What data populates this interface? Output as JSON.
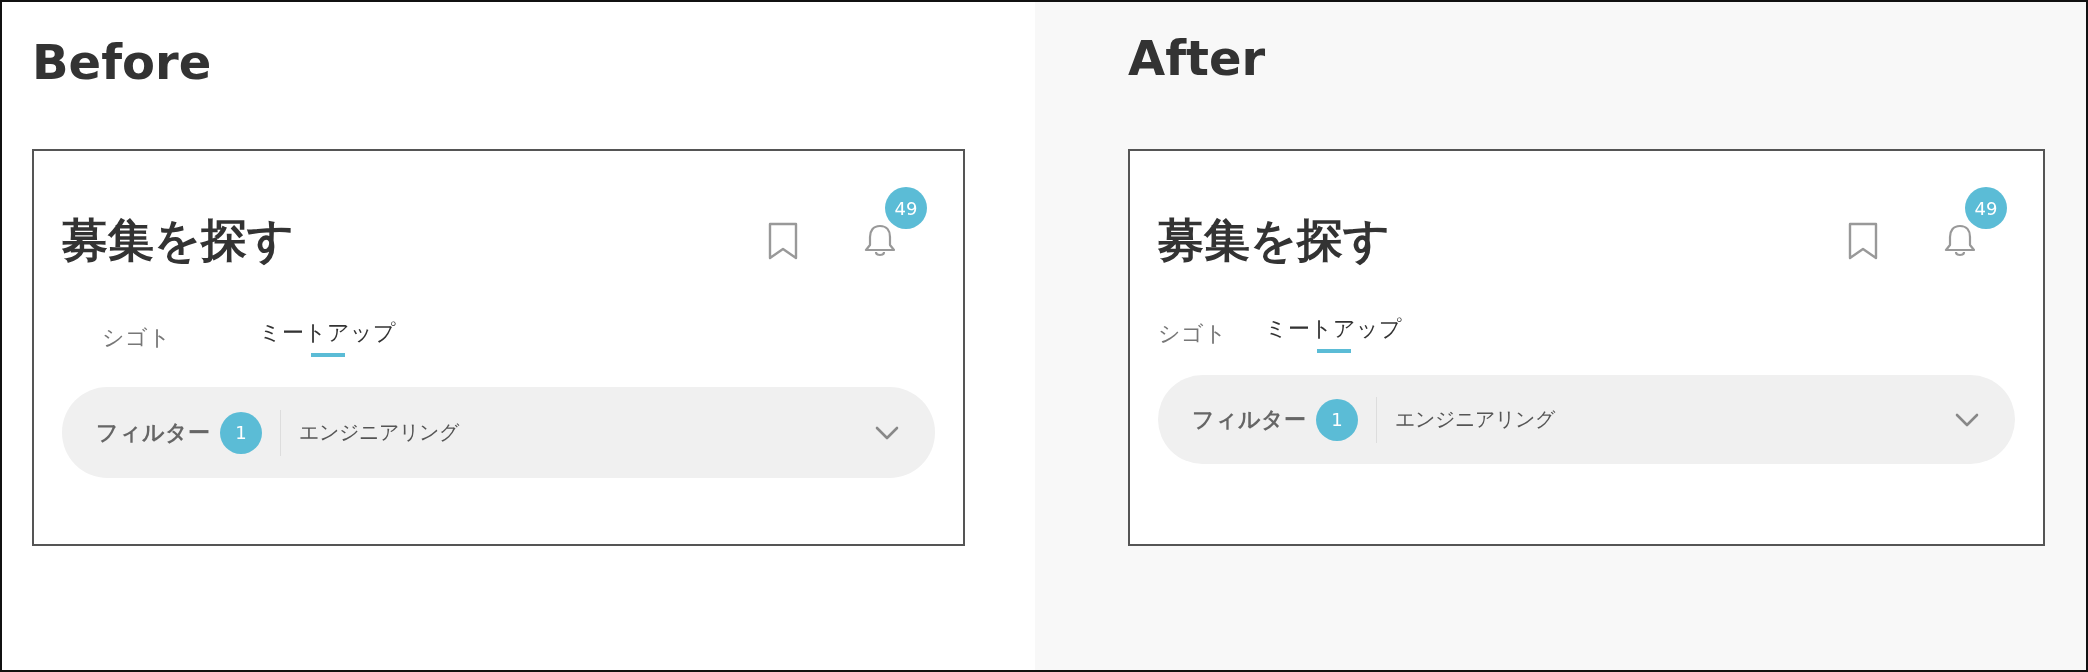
{
  "panels": [
    {
      "label": "Before",
      "kind": "spread",
      "title": "募集を探す",
      "notification_count": "49",
      "tabs": [
        {
          "label": "シゴト",
          "selected": false
        },
        {
          "label": "ミートアップ",
          "selected": true
        }
      ],
      "filter": {
        "label": "フィルター",
        "count": "1",
        "value": "エンジニアリング"
      }
    },
    {
      "label": "After",
      "kind": "compact",
      "title": "募集を探す",
      "notification_count": "49",
      "tabs": [
        {
          "label": "シゴト",
          "selected": false
        },
        {
          "label": "ミートアップ",
          "selected": true
        }
      ],
      "filter": {
        "label": "フィルター",
        "count": "1",
        "value": "エンジニアリング"
      }
    }
  ]
}
